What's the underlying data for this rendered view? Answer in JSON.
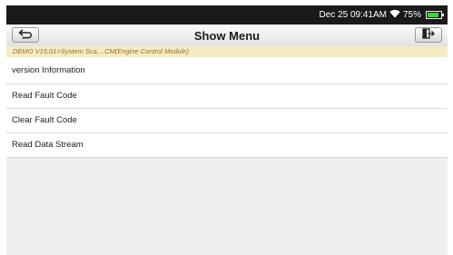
{
  "status_bar": {
    "datetime": "Dec 25 09:41AM",
    "battery": "75%",
    "battery_level": 0.75,
    "wifi_icon": "wifi-icon",
    "battery_icon": "battery-icon"
  },
  "toolbar": {
    "title": "Show Menu",
    "back_icon": "back-arrow-icon",
    "exit_icon": "exit-icon"
  },
  "breadcrumb": "DEMO V15.01>System Sca....CM(Engine Control Module)",
  "menu": {
    "items": [
      {
        "label": "version Information"
      },
      {
        "label": "Read Fault Code"
      },
      {
        "label": "Clear Fault Code"
      },
      {
        "label": "Read Data Stream"
      }
    ]
  },
  "colors": {
    "status_bg": "#1a1a1a",
    "breadcrumb_bg": "#f5ecc4",
    "breadcrumb_text": "#9c6b2c",
    "battery_fill": "#38d936"
  }
}
